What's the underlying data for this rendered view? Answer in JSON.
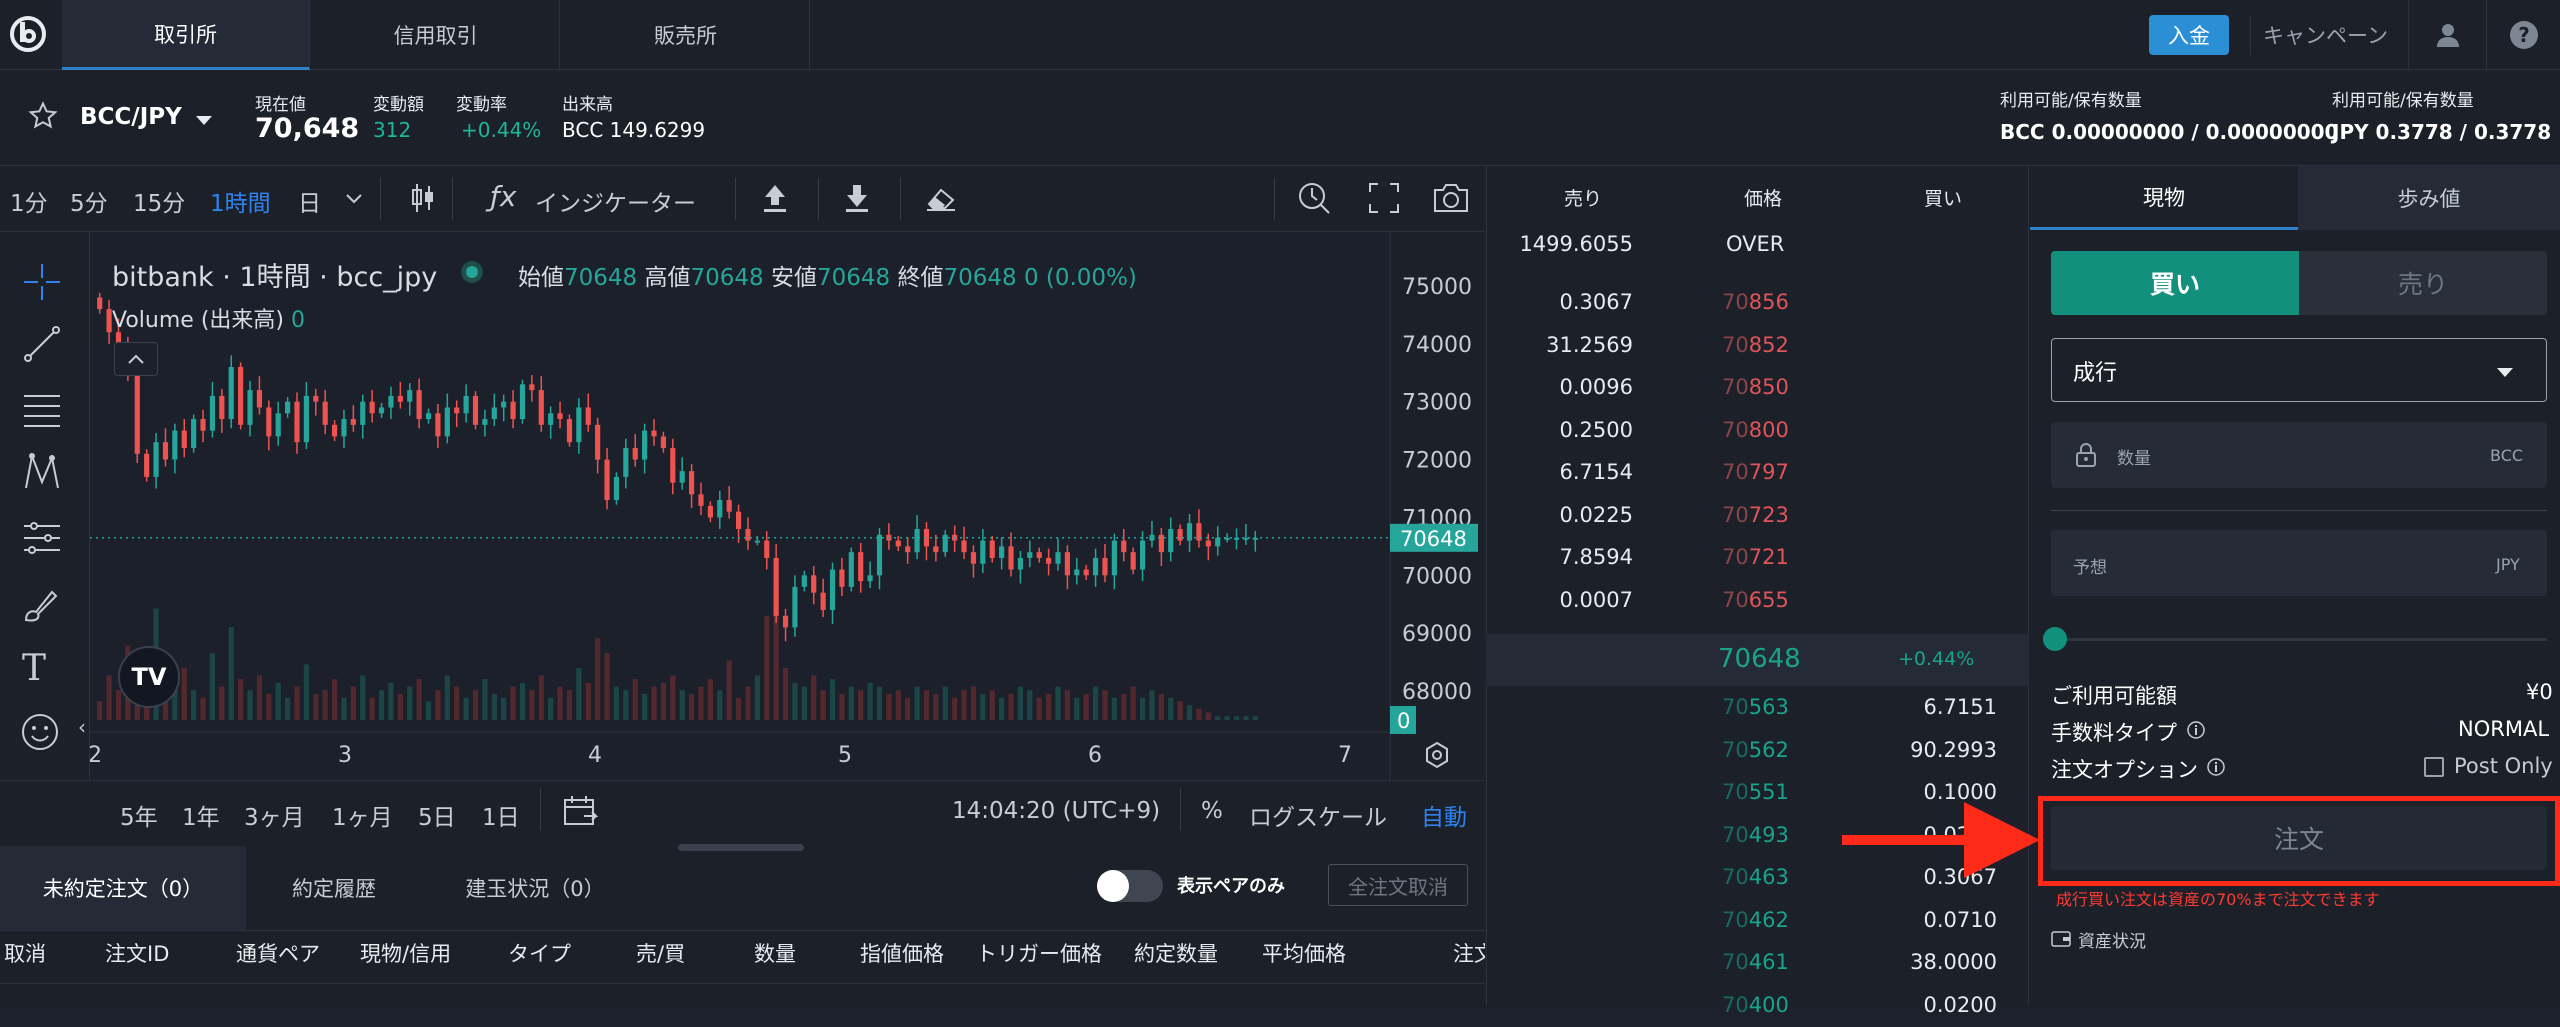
{
  "header": {
    "tabs": [
      "取引所",
      "信用取引",
      "販売所"
    ],
    "deposit_label": "入金",
    "campaign_label": "キャンペーン"
  },
  "ticker": {
    "pair": "BCC/JPY",
    "current_label": "現在値",
    "current_value": "70,648",
    "change_label": "変動額",
    "change_value": "312",
    "rate_label": "変動率",
    "rate_value": "+0.44%",
    "volume_label": "出来高",
    "volume_value": "BCC 149.6299",
    "avail1_label": "利用可能/保有数量",
    "avail1_value": "BCC 0.00000000 / 0.00000000",
    "avail2_label": "利用可能/保有数量",
    "avail2_value": "JPY 0.3778 / 0.3778"
  },
  "chart_toolbar": {
    "intervals": [
      "1分",
      "5分",
      "15分",
      "1時間",
      "日"
    ],
    "active_interval": "1時間",
    "indicator_label": "インジケーター"
  },
  "chart_legend": {
    "title": "bitbank · 1時間 · bcc_jpy",
    "open_label": "始値",
    "open": "70648",
    "high_label": "高値",
    "high": "70648",
    "low_label": "安値",
    "low": "70648",
    "close_label": "終値",
    "close": "70648",
    "change": "0 (0.00%)",
    "volume_label": "Volume (出来高)",
    "volume_value": "0"
  },
  "chart_bottom": {
    "ranges": [
      "5年",
      "1年",
      "3ヶ月",
      "1ヶ月",
      "5日",
      "1日"
    ],
    "time": "14:04:20 (UTC+9)",
    "percent": "%",
    "log": "ログスケール",
    "auto": "自動"
  },
  "chart_data": {
    "type": "candlestick",
    "y_ticks": [
      75000,
      74000,
      73000,
      72000,
      71000,
      70000,
      69000,
      68000
    ],
    "x_ticks": [
      "2",
      "3",
      "4",
      "5",
      "6",
      "7"
    ],
    "price_label": "70648",
    "volume_label": "0",
    "ylim": [
      67500,
      75500
    ],
    "closes": [
      74600,
      74200,
      74000,
      73600,
      72100,
      71700,
      72300,
      72000,
      72500,
      72200,
      72700,
      72500,
      73100,
      72700,
      73600,
      72600,
      73200,
      72900,
      72400,
      72800,
      73000,
      72300,
      73100,
      73000,
      72600,
      72400,
      72700,
      72600,
      73000,
      72800,
      72900,
      73100,
      73000,
      73200,
      72700,
      72800,
      72400,
      72900,
      72800,
      73100,
      72600,
      72700,
      72900,
      73000,
      72700,
      73300,
      73200,
      72600,
      72800,
      72700,
      72300,
      72900,
      72600,
      72000,
      71300,
      71700,
      72200,
      72000,
      72500,
      72400,
      72200,
      71600,
      71800,
      71400,
      71200,
      71000,
      71300,
      71100,
      70800,
      70600,
      70600,
      70300,
      69300,
      69100,
      69800,
      70000,
      69700,
      69400,
      70100,
      69800,
      70400,
      69900,
      70000,
      70700,
      70600,
      70500,
      70400,
      70800,
      70500,
      70400,
      70700,
      70600,
      70400,
      70200,
      70600,
      70300,
      70500,
      70100,
      70300,
      70400,
      70300,
      70200,
      70400,
      70000,
      70100,
      70000,
      70300,
      70000,
      70600,
      70400,
      70100,
      70600,
      70700,
      70400,
      70800,
      70600,
      70900,
      70600,
      70500,
      70648,
      70648,
      70648,
      70648,
      70648
    ],
    "volumes": [
      5,
      12,
      8,
      20,
      10,
      6,
      30,
      7,
      9,
      14,
      8,
      6,
      18,
      9,
      25,
      11,
      8,
      12,
      7,
      10,
      6,
      9,
      15,
      7,
      8,
      11,
      6,
      9,
      12,
      6,
      8,
      10,
      7,
      9,
      11,
      5,
      8,
      12,
      9,
      6,
      8,
      11,
      7,
      6,
      9,
      10,
      8,
      12,
      6,
      9,
      8,
      14,
      10,
      22,
      18,
      9,
      8,
      11,
      7,
      9,
      10,
      12,
      8,
      7,
      9,
      11,
      8,
      16,
      6,
      9,
      12,
      28,
      35,
      14,
      10,
      9,
      12,
      8,
      11,
      7,
      9,
      8,
      10,
      9,
      7,
      8,
      6,
      9,
      8,
      7,
      9,
      6,
      8,
      9,
      7,
      8,
      6,
      7,
      9,
      8,
      6,
      7,
      9,
      8,
      6,
      7,
      9,
      8,
      6,
      7,
      9,
      6,
      8,
      7,
      6,
      5,
      4,
      3,
      2,
      1,
      1,
      1,
      1,
      1
    ]
  },
  "bottom_panel": {
    "tabs": [
      "未約定注文（0）",
      "約定履歴",
      "建玉状況（0）"
    ],
    "toggle_label": "表示ペアのみ",
    "cancel_all": "全注文取消",
    "columns": [
      "取消",
      "注文ID",
      "通貨ペア",
      "現物/信用",
      "タイプ",
      "売/買",
      "数量",
      "指値価格",
      "トリガー価格",
      "約定数量",
      "平均価格",
      "注文"
    ]
  },
  "orderbook": {
    "headers": [
      "売り",
      "価格",
      "買い"
    ],
    "top": {
      "qty": "1499.6055",
      "price": "OVER"
    },
    "asks": [
      {
        "qty": "0.3067",
        "price_hi": "70",
        "price_lo": "856"
      },
      {
        "qty": "31.2569",
        "price_hi": "70",
        "price_lo": "852"
      },
      {
        "qty": "0.0096",
        "price_hi": "70",
        "price_lo": "850"
      },
      {
        "qty": "0.2500",
        "price_hi": "70",
        "price_lo": "800"
      },
      {
        "qty": "6.7154",
        "price_hi": "70",
        "price_lo": "797"
      },
      {
        "qty": "0.0225",
        "price_hi": "70",
        "price_lo": "723"
      },
      {
        "qty": "7.8594",
        "price_hi": "70",
        "price_lo": "721"
      },
      {
        "qty": "0.0007",
        "price_hi": "70",
        "price_lo": "655"
      }
    ],
    "last_price": "70648",
    "last_change": "+0.44%",
    "bids": [
      {
        "qty": "6.7151",
        "price_hi": "70",
        "price_lo": "563"
      },
      {
        "qty": "90.2993",
        "price_hi": "70",
        "price_lo": "562"
      },
      {
        "qty": "0.1000",
        "price_hi": "70",
        "price_lo": "551"
      },
      {
        "qty": "0.0240",
        "price_hi": "70",
        "price_lo": "493"
      },
      {
        "qty": "0.3067",
        "price_hi": "70",
        "price_lo": "463"
      },
      {
        "qty": "0.0710",
        "price_hi": "70",
        "price_lo": "462"
      },
      {
        "qty": "38.0000",
        "price_hi": "70",
        "price_lo": "461"
      },
      {
        "qty": "0.0200",
        "price_hi": "70",
        "price_lo": "400"
      }
    ]
  },
  "order_panel": {
    "tabs": [
      "現物",
      "歩み値"
    ],
    "buy_label": "買い",
    "sell_label": "売り",
    "order_type": "成行",
    "qty_placeholder": "数量",
    "qty_unit": "BCC",
    "est_placeholder": "予想",
    "est_unit": "JPY",
    "available_label": "ご利用可能額",
    "available_value": "¥0",
    "fee_label": "手数料タイプ",
    "fee_value": "NORMAL",
    "option_label": "注文オプション",
    "post_only": "Post Only",
    "submit_label": "注文",
    "warning": "成行買い注文は資産の70%まで注文できます",
    "asset_status": "資産状況"
  },
  "colors": {
    "up": "#26a69a",
    "down": "#ef5350",
    "ask_price": "#e0545a",
    "bid_price": "#19a38b",
    "accent": "#2f82c8",
    "highlight": "#ff2a1a"
  }
}
